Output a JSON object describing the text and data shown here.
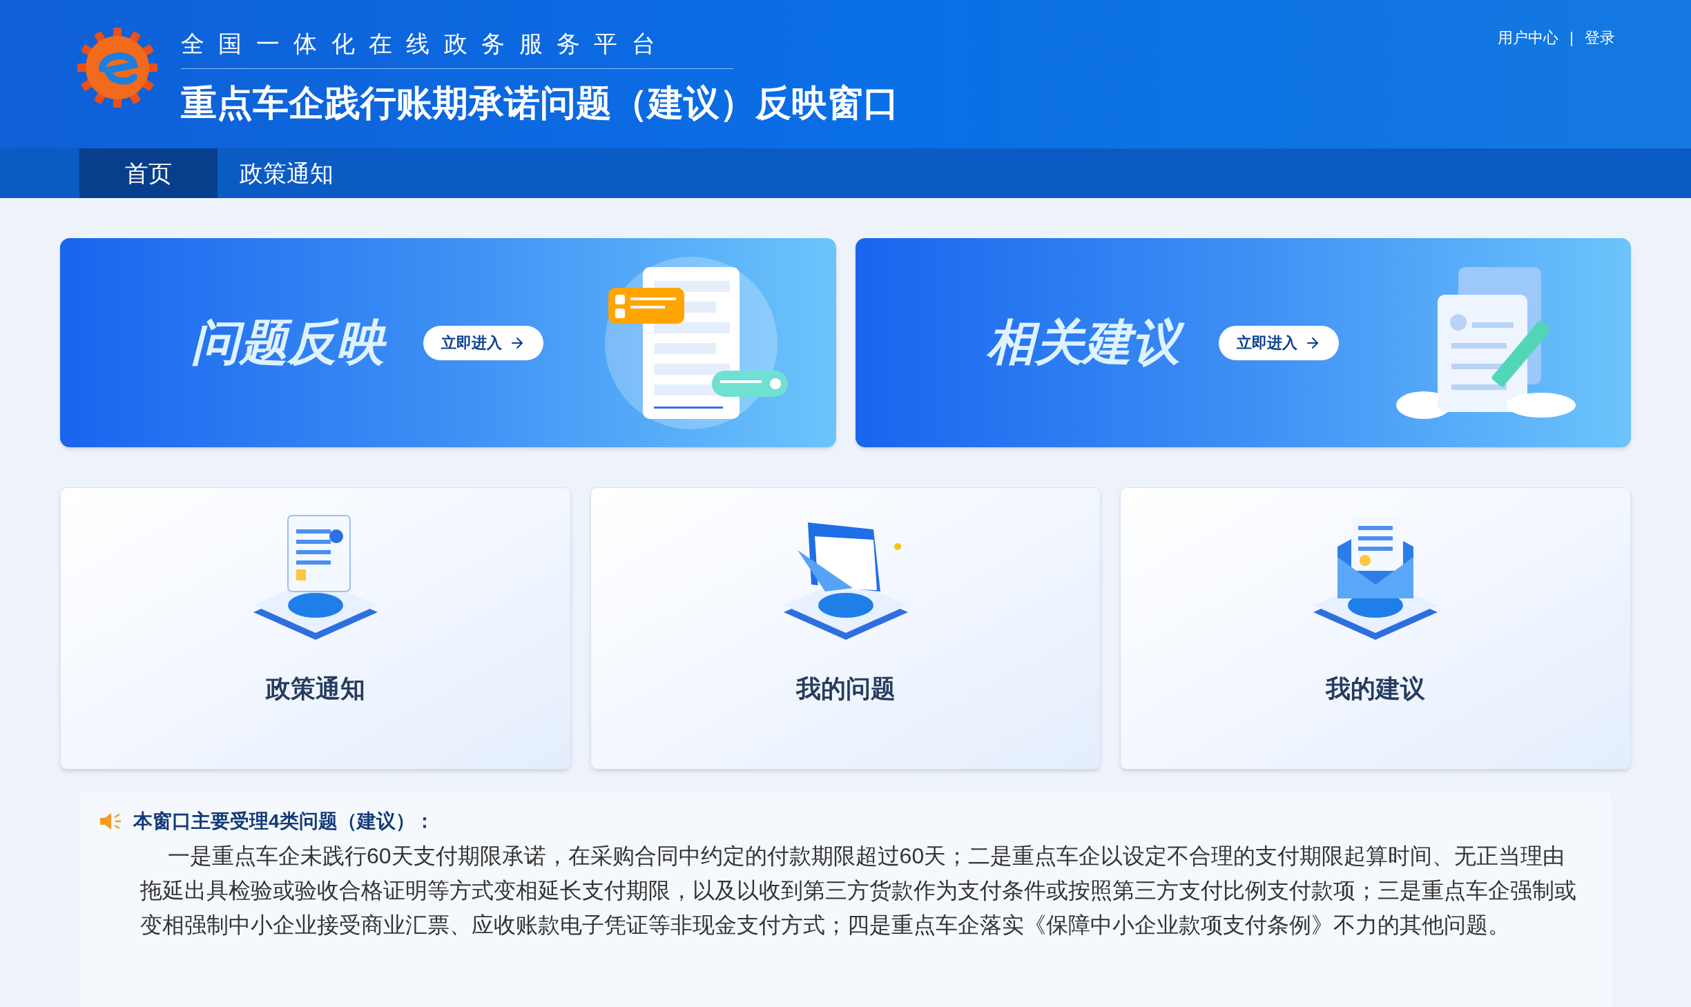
{
  "header": {
    "platform": "全国一体化在线政务服务平台",
    "title": "重点车企践行账期承诺问题（建议）反映窗口",
    "links": [
      "用户中心",
      "登录"
    ],
    "separator": "|"
  },
  "nav": [
    {
      "label": "首页",
      "selected": true
    },
    {
      "label": "政策通知",
      "selected": false
    }
  ],
  "banners": [
    {
      "title": "问题反映",
      "button": "立即进入",
      "kind": "chat"
    },
    {
      "title": "相关建议",
      "button": "立即进入",
      "kind": "edit"
    }
  ],
  "cards": [
    {
      "label": "政策通知",
      "kind": "document"
    },
    {
      "label": "我的问题",
      "kind": "folder"
    },
    {
      "label": "我的建议",
      "kind": "envelope"
    }
  ],
  "notice": {
    "heading": "本窗口主要受理4类问题（建议）：",
    "body": "一是重点车企未践行60天支付期限承诺，在采购合同中约定的付款期限超过60天；二是重点车企以设定不合理的支付期限起算时间、无正当理由拖延出具检验或验收合格证明等方式变相延长支付期限，以及以收到第三方货款作为支付条件或按照第三方支付比例支付款项；三是重点车企强制或变相强制中小企业接受商业汇票、应收账款电子凭证等非现金支付方式；四是重点车企落实《保障中小企业款项支付条例》不力的其他问题。"
  }
}
